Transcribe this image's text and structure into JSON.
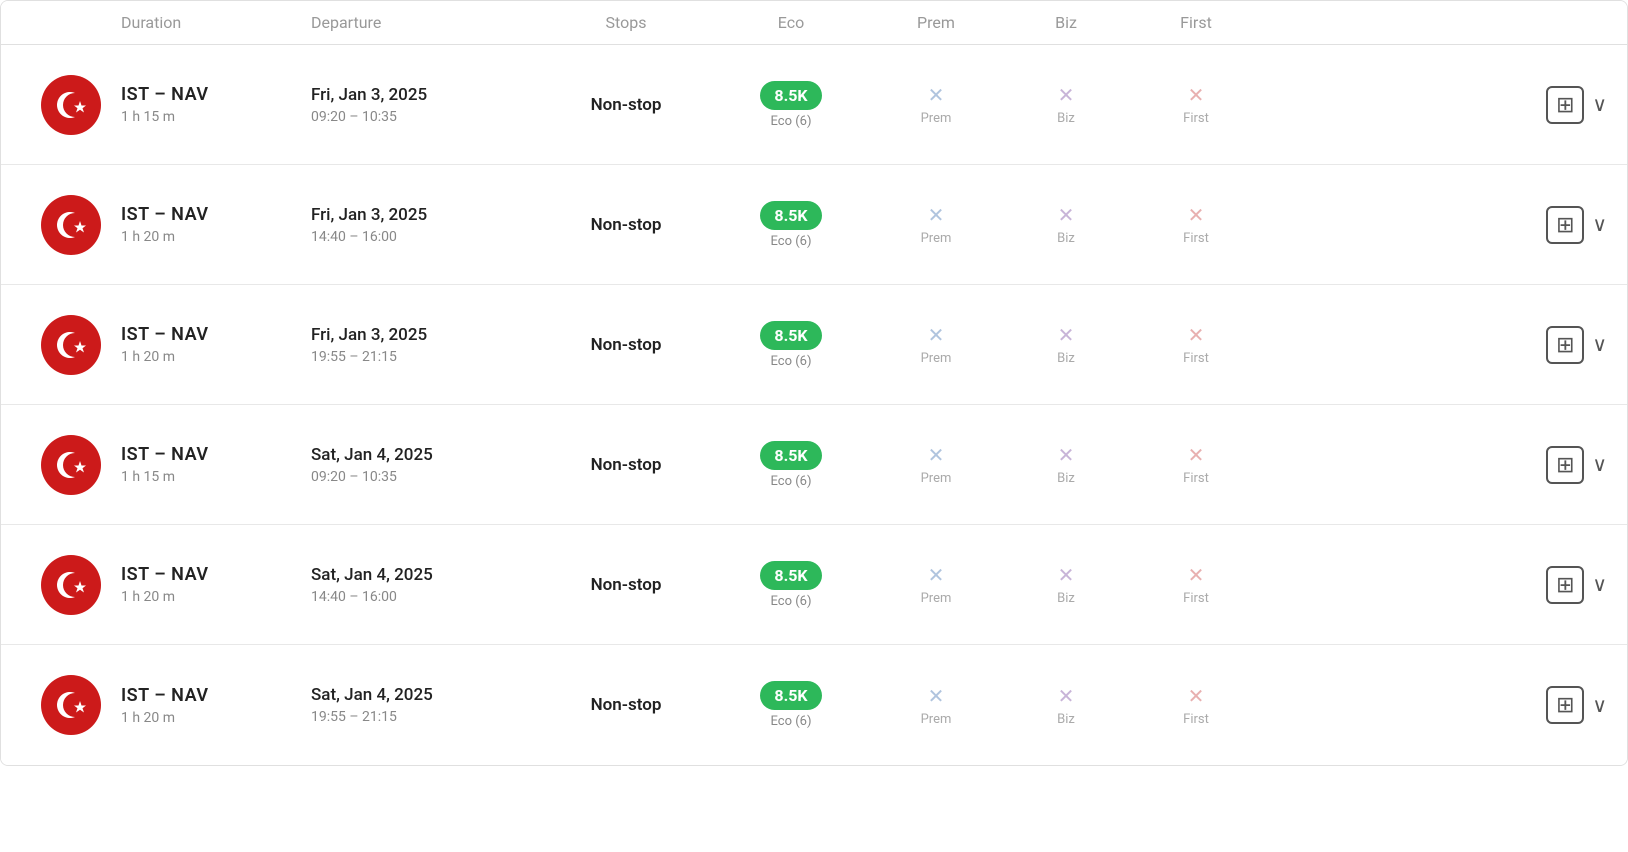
{
  "header": {
    "col_logo": "",
    "col_duration": "Duration",
    "col_departure": "Departure",
    "col_stops": "Stops",
    "col_eco": "Eco",
    "col_prem": "Prem",
    "col_biz": "Biz",
    "col_first": "First"
  },
  "flights": [
    {
      "route": "IST – NAV",
      "duration": "1 h 15 m",
      "date": "Fri, Jan 3, 2025",
      "time": "09:20 – 10:35",
      "stops": "Non-stop",
      "eco_price": "8.5K",
      "eco_label": "Eco (6)",
      "prem_label": "Prem",
      "biz_label": "Biz",
      "first_label": "First"
    },
    {
      "route": "IST – NAV",
      "duration": "1 h 20 m",
      "date": "Fri, Jan 3, 2025",
      "time": "14:40 – 16:00",
      "stops": "Non-stop",
      "eco_price": "8.5K",
      "eco_label": "Eco (6)",
      "prem_label": "Prem",
      "biz_label": "Biz",
      "first_label": "First"
    },
    {
      "route": "IST – NAV",
      "duration": "1 h 20 m",
      "date": "Fri, Jan 3, 2025",
      "time": "19:55 – 21:15",
      "stops": "Non-stop",
      "eco_price": "8.5K",
      "eco_label": "Eco (6)",
      "prem_label": "Prem",
      "biz_label": "Biz",
      "first_label": "First"
    },
    {
      "route": "IST – NAV",
      "duration": "1 h 15 m",
      "date": "Sat, Jan 4, 2025",
      "time": "09:20 – 10:35",
      "stops": "Non-stop",
      "eco_price": "8.5K",
      "eco_label": "Eco (6)",
      "prem_label": "Prem",
      "biz_label": "Biz",
      "first_label": "First"
    },
    {
      "route": "IST – NAV",
      "duration": "1 h 20 m",
      "date": "Sat, Jan 4, 2025",
      "time": "14:40 – 16:00",
      "stops": "Non-stop",
      "eco_price": "8.5K",
      "eco_label": "Eco (6)",
      "prem_label": "Prem",
      "biz_label": "Biz",
      "first_label": "First"
    },
    {
      "route": "IST – NAV",
      "duration": "1 h 20 m",
      "date": "Sat, Jan 4, 2025",
      "time": "19:55 – 21:15",
      "stops": "Non-stop",
      "eco_price": "8.5K",
      "eco_label": "Eco (6)",
      "prem_label": "Prem",
      "biz_label": "Biz",
      "first_label": "First"
    }
  ],
  "icons": {
    "add": "⊞",
    "chevron": "∨",
    "x": "✕"
  }
}
